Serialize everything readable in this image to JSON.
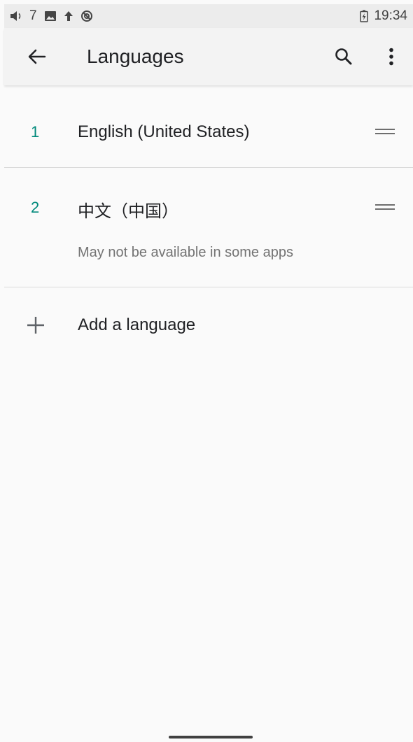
{
  "status_bar": {
    "notification_count": "7",
    "time": "19:34",
    "icons": [
      "volume-icon",
      "image-icon",
      "upload-arrow-icon",
      "sync-icon",
      "battery-icon"
    ]
  },
  "app_bar": {
    "title": "Languages",
    "icons": [
      "back-arrow-icon",
      "search-icon",
      "more-vert-icon"
    ]
  },
  "languages": [
    {
      "index": "1",
      "name": "English (United States)"
    },
    {
      "index": "2",
      "name": "中文（中国）",
      "note": "May not be available in some apps"
    }
  ],
  "add_language": {
    "label": "Add a language",
    "icon": "plus-icon"
  },
  "colors": {
    "accent": "#00897b",
    "background": "#fafafa",
    "app_bar": "#f3f3f3",
    "status_bar": "#ececec",
    "primary_text": "#202124",
    "secondary_text": "#737373"
  }
}
